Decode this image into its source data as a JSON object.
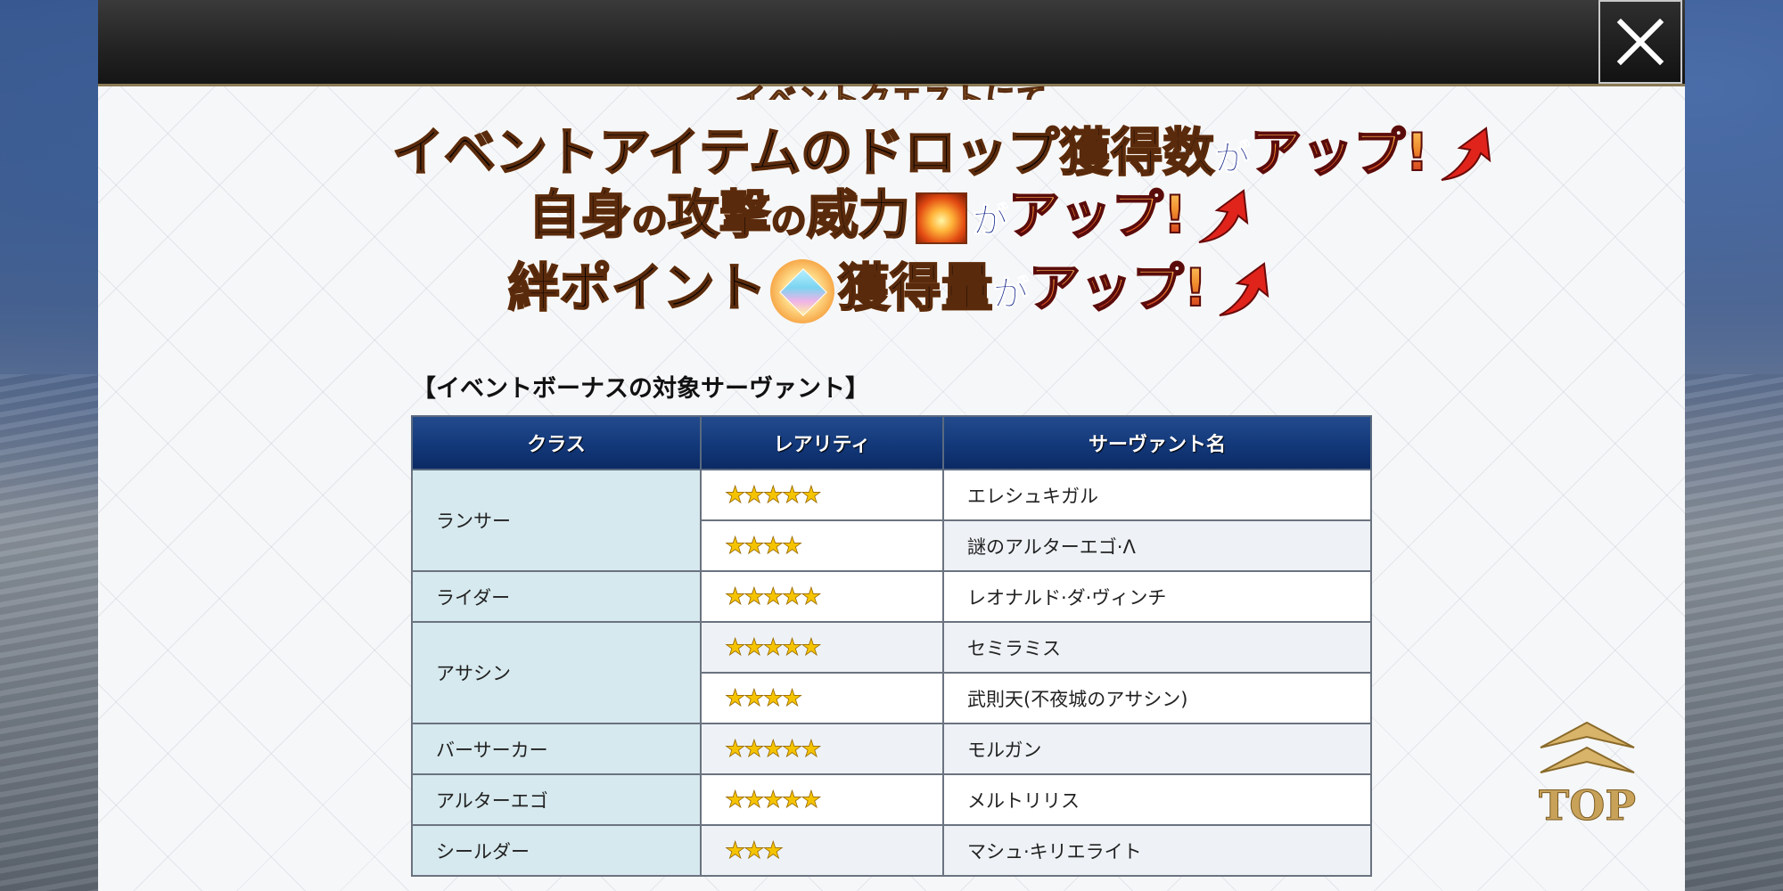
{
  "banner": {
    "line0": "イベントクエストにて",
    "line1_a": "イベントアイテムのドロップ獲得数",
    "line1_b": "が",
    "line1_c": "アップ!",
    "line2_a": "自身",
    "line2_b": "の",
    "line2_c": "攻撃",
    "line2_d": "の",
    "line2_e": "威力",
    "line2_f": "が",
    "line2_g": "アップ!",
    "line3_a": "絆ポイント",
    "line3_b": "獲得量",
    "line3_c": "が",
    "line3_d": "アップ!"
  },
  "section_title": "【イベントボーナスの対象サーヴァント】",
  "table": {
    "headers": [
      "クラス",
      "レアリティ",
      "サーヴァント名"
    ],
    "classes": [
      "ランサー",
      "ライダー",
      "アサシン",
      "バーサーカー",
      "アルターエゴ",
      "シールダー"
    ],
    "rows": [
      {
        "stars": "★★★★★",
        "name": "エレシュキガル"
      },
      {
        "stars": "★★★★",
        "name": "謎のアルターエゴ·Λ"
      },
      {
        "stars": "★★★★★",
        "name": "レオナルド·ダ·ヴィンチ"
      },
      {
        "stars": "★★★★★",
        "name": "セミラミス"
      },
      {
        "stars": "★★★★",
        "name": "武則天(不夜城のアサシン)"
      },
      {
        "stars": "★★★★★",
        "name": "モルガン"
      },
      {
        "stars": "★★★★★",
        "name": "メルトリリス"
      },
      {
        "stars": "★★★",
        "name": "マシュ·キリエライト"
      }
    ]
  },
  "top_button": "TOP",
  "colors": {
    "header_bg": "#143a7c",
    "class_cell_bg": "#d6e9ee",
    "star": "#f5c400"
  }
}
